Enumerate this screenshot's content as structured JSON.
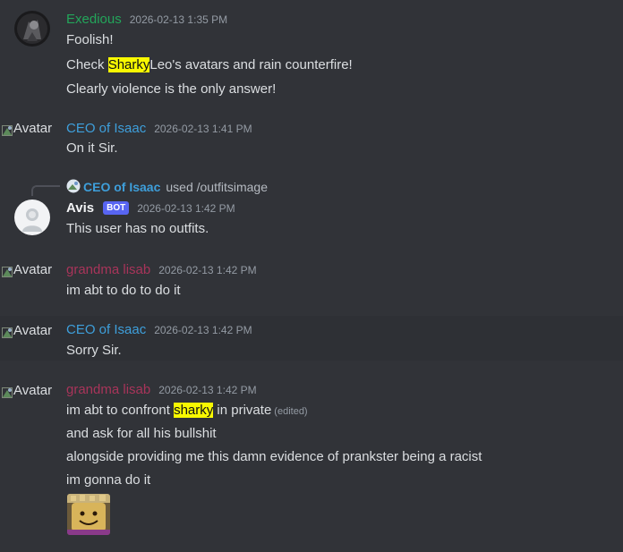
{
  "avatar_alt": "Avatar",
  "colors": {
    "exedious": "#23a55a",
    "ceo": "#3e9fdb",
    "grandma": "#a8345a",
    "bot_badge": "#5865f2",
    "highlight": "#f8f801"
  },
  "messages": [
    {
      "author": "Exedious",
      "timestamp": "2026-02-13 1:35 PM",
      "lines": [
        "Foolish!",
        {
          "pre": "Check ",
          "hl": "Sharky",
          "post": "Leo's avatars and rain counterfire!"
        },
        "Clearly violence is the only answer!"
      ]
    },
    {
      "author": "CEO of Isaac",
      "timestamp": "2026-02-13 1:41 PM",
      "lines": [
        "On it Sir."
      ]
    },
    {
      "reply_author": "CEO of Isaac",
      "reply_command": "used /outfitsimage",
      "author": "Avis",
      "badge": "BOT",
      "timestamp": "2026-02-13 1:42 PM",
      "lines": [
        "This user has no outfits."
      ]
    },
    {
      "author": "grandma lisab",
      "timestamp": "2026-02-13 1:42 PM",
      "lines": [
        "im abt to do to do it"
      ]
    },
    {
      "author": "CEO of Isaac",
      "timestamp": "2026-02-13 1:42 PM",
      "lines": [
        "Sorry Sir."
      ]
    },
    {
      "author": "grandma lisab",
      "timestamp": "2026-02-13 1:42 PM",
      "lines": [
        {
          "pre": "im abt to confront ",
          "hl": "sharky",
          "post": " in private",
          "edited": "(edited)"
        },
        "and ask for all his bullshit",
        "alongside providing me this damn evidence of prankster being a racist",
        "im gonna do it"
      ]
    }
  ]
}
